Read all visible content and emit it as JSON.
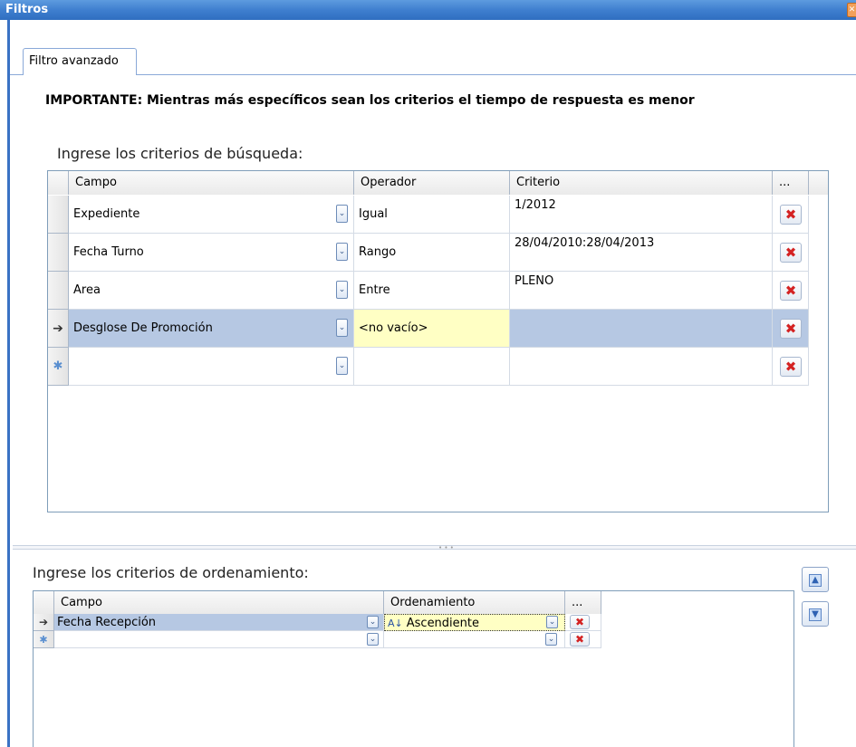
{
  "window": {
    "title": "Filtros"
  },
  "tabs": [
    {
      "label": "Filtro avanzado"
    }
  ],
  "notice": "IMPORTANTE: Mientras más específicos sean los criterios el tiempo de respuesta es menor",
  "search": {
    "label": "Ingrese los criterios de búsqueda:",
    "columns": [
      "Campo",
      "Operador",
      "Criterio",
      "..."
    ],
    "rows": [
      {
        "campo": "Expediente",
        "operador": "Igual",
        "criterio": "1/2012",
        "current": false
      },
      {
        "campo": "Fecha Turno",
        "operador": "Rango",
        "criterio": "28/04/2010:28/04/2013",
        "current": false
      },
      {
        "campo": "Area",
        "operador": "Entre",
        "criterio": "PLENO",
        "current": false
      },
      {
        "campo": "Desglose De Promoción",
        "operador": "<no vacío>",
        "criterio": "",
        "current": true
      },
      {
        "campo": "",
        "operador": "",
        "criterio": "",
        "current": false
      }
    ]
  },
  "order": {
    "label": "Ingrese los criterios de ordenamiento:",
    "columns": [
      "Campo",
      "Ordenamiento",
      "..."
    ],
    "rows": [
      {
        "campo": "Fecha Recepción",
        "ordenamiento": "Ascendiente",
        "current": true
      },
      {
        "campo": "",
        "ordenamiento": "",
        "current": false
      }
    ]
  },
  "icons": {
    "current_row": "arrow-right-icon",
    "new_row": "asterisk-icon",
    "dropdown": "chevron-down-icon",
    "delete": "red-x-icon",
    "sort_asc": "sort-az-icon",
    "move_up": "arrow-up-icon",
    "move_down": "arrow-down-icon"
  },
  "colors": {
    "titlebar": "#3f7fcf",
    "selected_row": "#b6c8e3",
    "editing_cell": "#ffffc4",
    "delete": "#d42222"
  }
}
